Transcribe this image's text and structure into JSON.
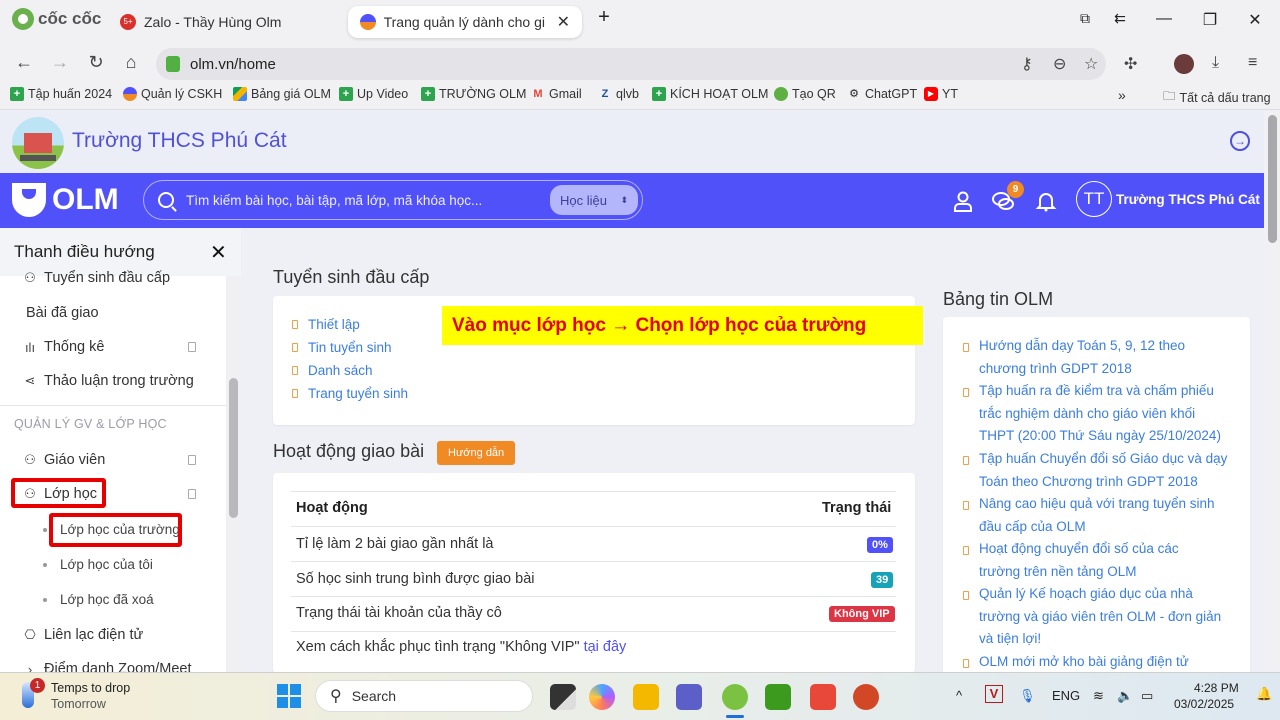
{
  "browser": {
    "brand": "cốc cốc",
    "tabs": [
      {
        "label": "Zalo - Thầy Hùng Olm",
        "badge": "5+",
        "active": false
      },
      {
        "label": "Trang quản lý dành cho giáo",
        "active": true
      }
    ],
    "new_tab": "+",
    "window_controls": {
      "minimize": "—",
      "restore": "❐",
      "close": "✕"
    },
    "url": "olm.vn/home",
    "bookmarks": [
      {
        "label": "Tập huấn 2024",
        "icon": "green-plus-icon",
        "color": "#2ea44f"
      },
      {
        "label": "Quản lý CSKH",
        "icon": "olm-icon",
        "color": "#f08a24"
      },
      {
        "label": "Bảng giá OLM",
        "icon": "google-drive-icon",
        "color": "#f4b400"
      },
      {
        "label": "Up Video",
        "icon": "green-plus-icon",
        "color": "#2ea44f"
      },
      {
        "label": "TRƯỜNG OLM",
        "icon": "green-plus-icon",
        "color": "#2ea44f"
      },
      {
        "label": "Gmail",
        "icon": "gmail-icon",
        "color": "#ea4335"
      },
      {
        "label": "qlvb",
        "icon": "qlvb-icon",
        "color": "#1f4fa3"
      },
      {
        "label": "KÍCH HOẠT OLM",
        "icon": "green-plus-icon",
        "color": "#2ea44f"
      },
      {
        "label": "Tạo QR",
        "icon": "qr-icon",
        "color": "#5fb043"
      },
      {
        "label": "ChatGPT",
        "icon": "chatgpt-icon",
        "color": "#222222"
      },
      {
        "label": "YT",
        "icon": "youtube-icon",
        "color": "#ff0000"
      }
    ],
    "more_bookmarks": "»",
    "all_bookmarks": "Tất cả dấu trang"
  },
  "school": {
    "name": "Trường THCS Phú Cát"
  },
  "header": {
    "logo": "OLM",
    "search_placeholder": "Tìm kiếm bài học, bài tập, mã lớp, mã khóa học...",
    "search_scope": "Học liệu",
    "messages_badge": "9",
    "user_initials": "TT",
    "user_name": "Trường THCS Phú Cát",
    "brand_color": "#5051f9"
  },
  "sidebar": {
    "title": "Thanh điều hướng",
    "close": "✕",
    "items_top": [
      {
        "label": "Tuyển sinh đầu cấp",
        "icon": "user-plus-icon"
      },
      {
        "label": "Bài đã giao",
        "icon": ""
      },
      {
        "label": "Thống kê",
        "icon": "bar-chart-icon"
      },
      {
        "label": "Thảo luận trong trường",
        "icon": "share-icon"
      }
    ],
    "section_label": "QUẢN LÝ GV & LỚP HỌC",
    "items_section": [
      {
        "label": "Giáo viên",
        "icon": "users-icon"
      },
      {
        "label": "Lớp học",
        "icon": "user-plus-icon"
      }
    ],
    "class_subitems": [
      "Lớp học của trường",
      "Lớp học của tôi",
      "Lớp học đã xoá"
    ],
    "items_bottom": [
      {
        "label": "Liên lạc điện tử",
        "icon": "inbox-icon"
      },
      {
        "label": "Điểm danh Zoom/Meet",
        "icon": "chevron-right-icon"
      }
    ]
  },
  "annotation": {
    "callout": "Vào mục lớp học → Chọn lớp học của trường"
  },
  "admission": {
    "title": "Tuyển sinh đầu cấp",
    "links": [
      "Thiết lập",
      "Tin tuyển sinh",
      "Danh sách",
      "Trang tuyển sinh"
    ]
  },
  "activity": {
    "title": "Hoạt động giao bài",
    "guide_button": "Hướng dẫn",
    "columns": [
      "Hoạt động",
      "Trạng thái"
    ],
    "rows": [
      {
        "label": "Tỉ lệ làm 2 bài giao gần nhất là",
        "status": "0%",
        "color": "#5051f9"
      },
      {
        "label": "Số học sinh trung bình được giao bài",
        "status": "39",
        "color": "#17a2b8"
      },
      {
        "label": "Trạng thái tài khoản của thầy cô",
        "status": "Không VIP",
        "color": "#dc3545"
      }
    ],
    "fix_text": "Xem cách khắc phục tình trạng \"Không VIP\"",
    "fix_link": "tại đây"
  },
  "news": {
    "title": "Bảng tin OLM",
    "items": [
      "Hướng dẫn dạy Toán 5, 9, 12 theo chương trình GDPT 2018",
      "Tập huấn ra đề kiểm tra và chấm phiếu trắc nghiệm dành cho giáo viên khối THPT (20:00 Thứ Sáu ngày 25/10/2024)",
      "Tập huấn Chuyển đổi số Giáo dục và dạy Toán theo Chương trình GDPT 2018",
      "Nâng cao hiệu quả với trang tuyển sinh đầu cấp của OLM",
      "Hoạt động chuyển đổi số của các trường trên nền tảng OLM",
      "Quản lý Kế hoạch giáo dục của nhà trường và giáo viên trên OLM - đơn giản và tiện lợi!",
      "OLM mới mở kho bài giảng điện tử"
    ]
  },
  "taskbar": {
    "weather_title": "Temps to drop",
    "weather_sub": "Tomorrow",
    "weather_badge": "1",
    "search": "Search",
    "language": "ENG",
    "time": "4:28 PM",
    "date": "03/02/2025"
  }
}
